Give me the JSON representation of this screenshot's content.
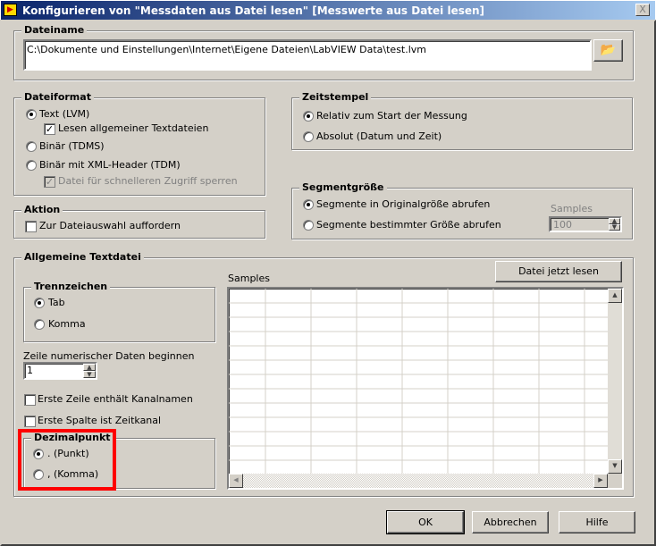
{
  "window": {
    "title": "Konfigurieren von \"Messdaten aus Datei lesen\" [Messwerte aus Datei lesen]",
    "close": "X"
  },
  "dateiname": {
    "legend": "Dateiname",
    "path": "C:\\Dokumente und Einstellungen\\Internet\\Eigene Dateien\\LabVIEW Data\\test.lvm"
  },
  "dateiformat": {
    "legend": "Dateiformat",
    "text_lvm": "Text (LVM)",
    "lesen_allgemein": "Lesen allgemeiner Textdateien",
    "binaer_tdms": "Binär (TDMS)",
    "binaer_xml": "Binär mit XML-Header (TDM)",
    "sperren": "Datei für schnelleren Zugriff sperren"
  },
  "aktion": {
    "legend": "Aktion",
    "auffordern": "Zur Dateiauswahl auffordern"
  },
  "zeitstempel": {
    "legend": "Zeitstempel",
    "relativ": "Relativ zum Start der Messung",
    "absolut": "Absolut (Datum und Zeit)"
  },
  "segment": {
    "legend": "Segmentgröße",
    "original": "Segmente in Originalgröße abrufen",
    "bestimmt": "Segmente bestimmter Größe abrufen",
    "samples_label": "Samples",
    "samples_value": "100"
  },
  "allgemein": {
    "legend": "Allgemeine Textdatei",
    "lesen_button": "Datei jetzt lesen",
    "samples_label": "Samples",
    "trenn": {
      "legend": "Trennzeichen",
      "tab": "Tab",
      "komma": "Komma"
    },
    "zeile_label": "Zeile numerischer Daten beginnen",
    "zeile_value": "1",
    "erste_zeile": "Erste Zeile enthält Kanalnamen",
    "erste_spalte": "Erste Spalte ist Zeitkanal",
    "dezimal": {
      "legend": "Dezimalpunkt",
      "punkt": ". (Punkt)",
      "komma": ", (Komma)"
    }
  },
  "footer": {
    "ok": "OK",
    "abbrechen": "Abbrechen",
    "hilfe": "Hilfe"
  },
  "highlight_color": "#ff0000"
}
